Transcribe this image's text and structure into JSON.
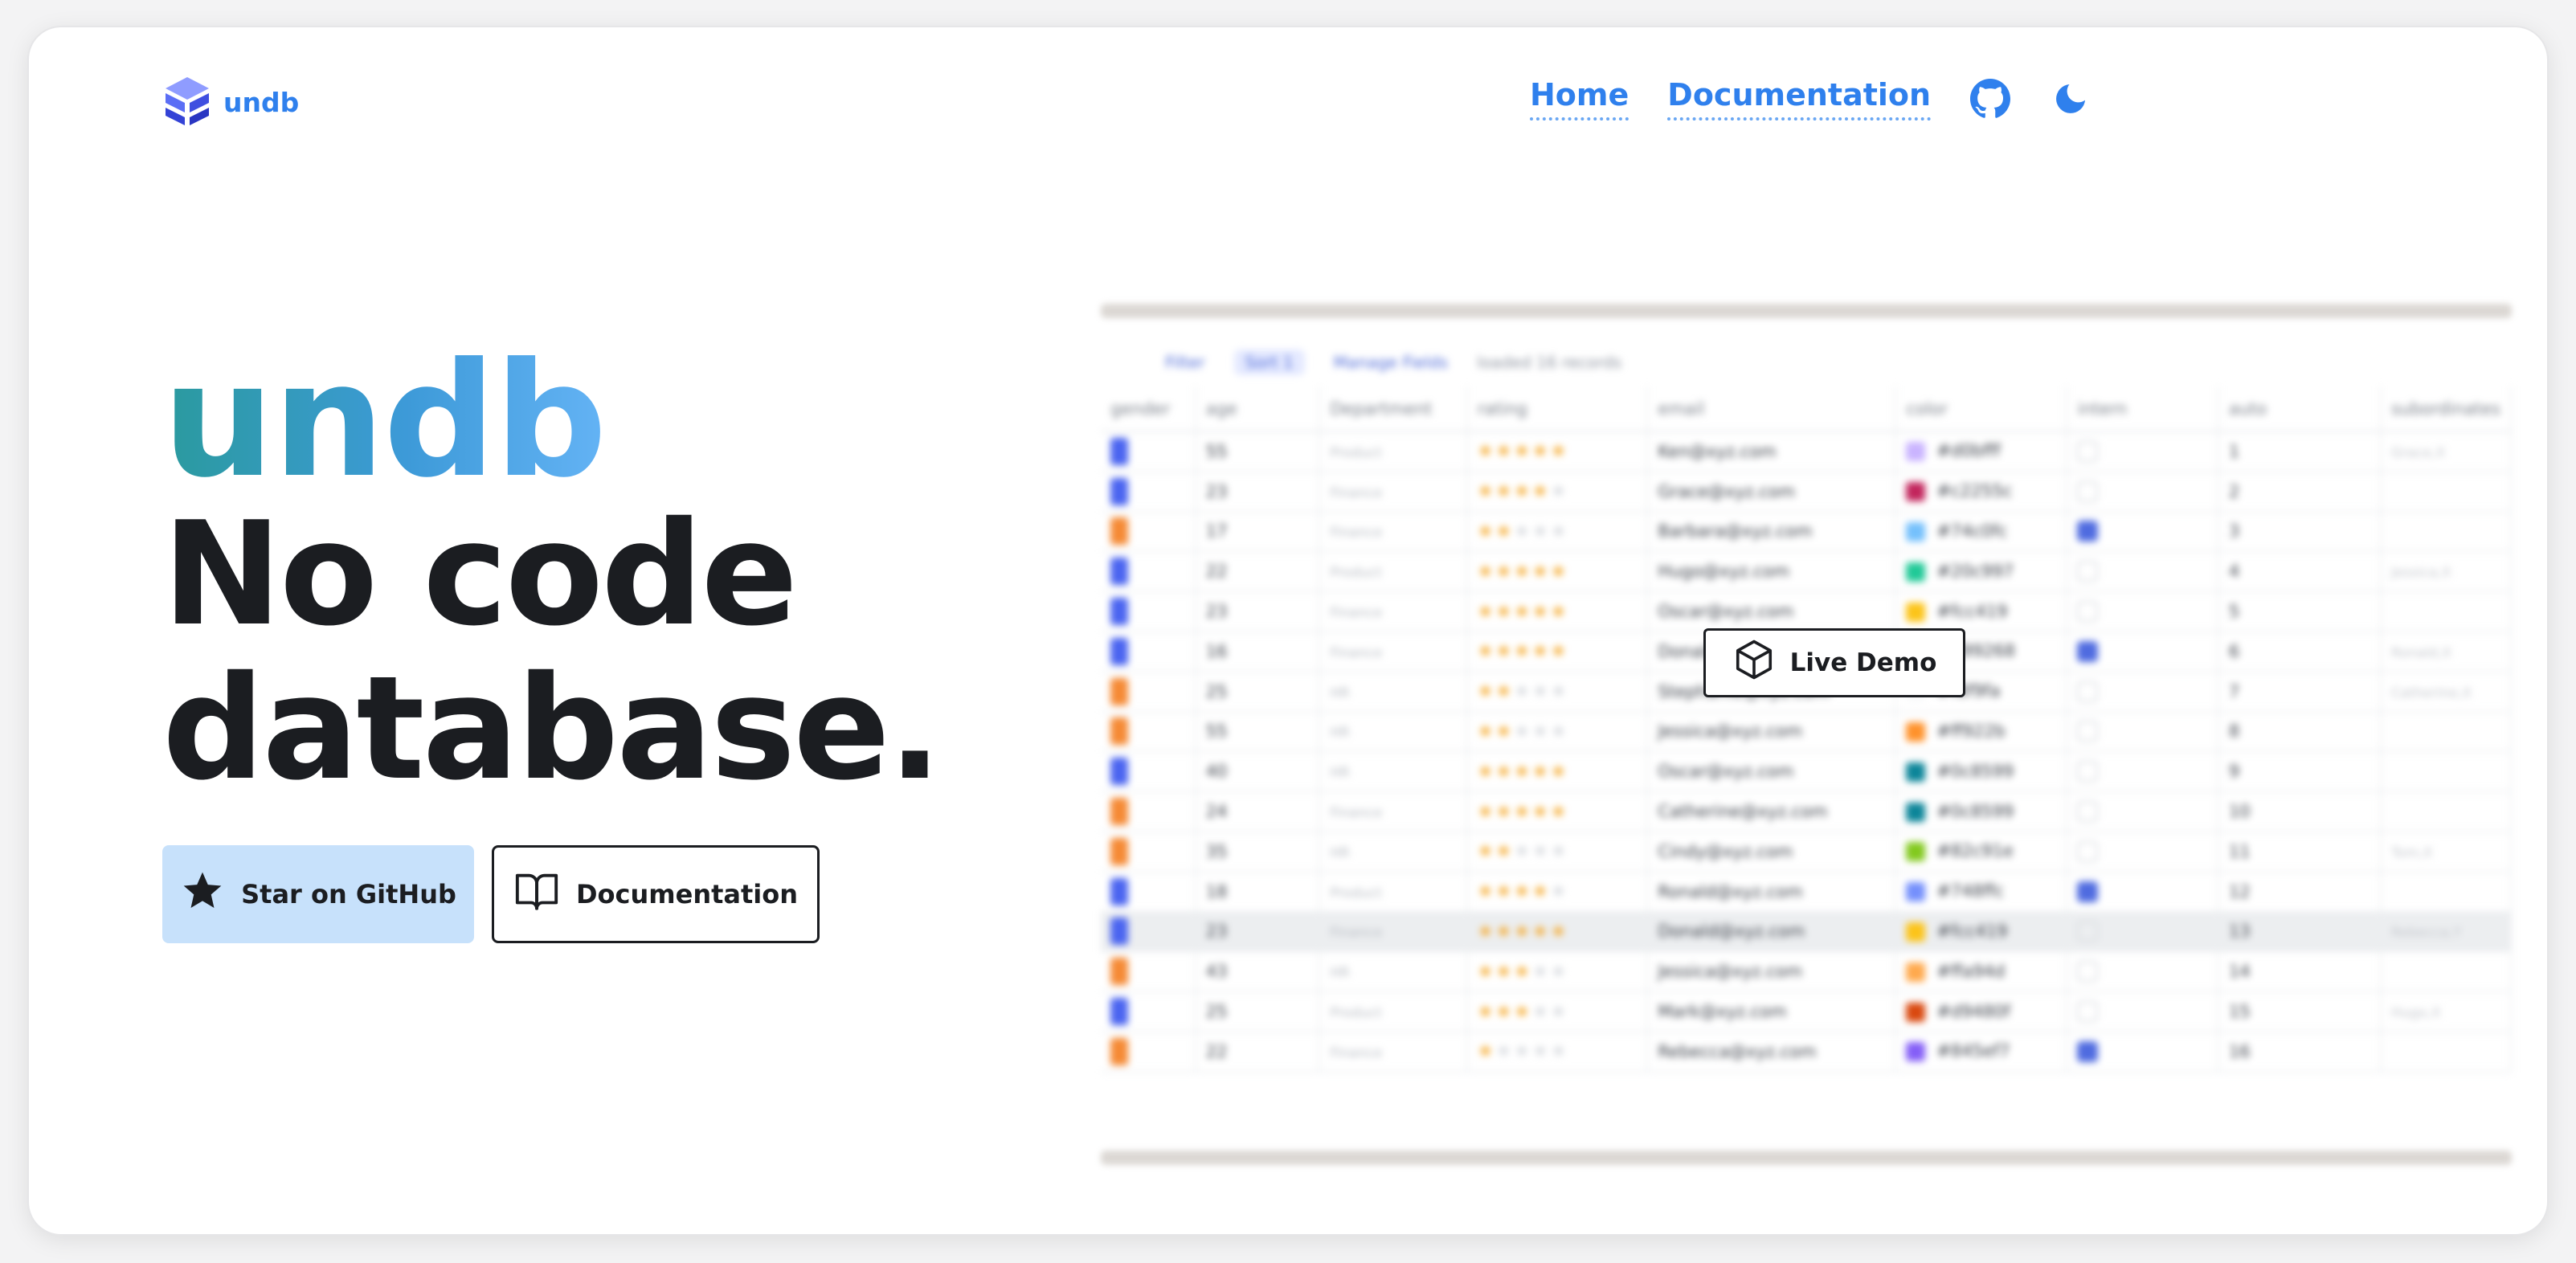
{
  "header": {
    "brand": "undb",
    "nav": [
      {
        "label": "Home"
      },
      {
        "label": "Documentation"
      }
    ],
    "icons": [
      "github-icon",
      "moon-icon"
    ]
  },
  "hero": {
    "brand": "undb",
    "title_line1": "No code",
    "title_line2": "database.",
    "star_button": "Star on GitHub",
    "doc_button": "Documentation",
    "brand_gradient": [
      "#2a9a9e",
      "#64b3f5"
    ]
  },
  "preview": {
    "toolbar": {
      "filter": "Filter",
      "sort": "Sort",
      "sort_count": "1",
      "manage": "Manage Fields",
      "loaded": "loaded 16 records"
    },
    "columns": [
      "gender",
      "age",
      "Department",
      "rating",
      "email",
      "color",
      "intern",
      "auto",
      "subordinates"
    ],
    "rows": [
      {
        "gender": "#4a64f0",
        "age": "55",
        "dept": "Product",
        "rating": 5,
        "email": "Ken@xyz.com",
        "color_swatch": "#c9b3ff",
        "color": "#d0bfff",
        "intern": false,
        "auto": "1",
        "sub": "Grace,X"
      },
      {
        "gender": "#4a64f0",
        "age": "23",
        "dept": "Finance",
        "rating": 4,
        "email": "Grace@xyz.com",
        "color_swatch": "#c2255c",
        "color": "#c2255c",
        "intern": false,
        "auto": "2",
        "sub": ""
      },
      {
        "gender": "#f58a35",
        "age": "17",
        "dept": "Finance",
        "rating": 2,
        "email": "Barbara@xyz.com",
        "color_swatch": "#74c0fc",
        "color": "#74c0fc",
        "intern": true,
        "auto": "3",
        "sub": ""
      },
      {
        "gender": "#4a64f0",
        "age": "22",
        "dept": "Product",
        "rating": 5,
        "email": "Hugo@xyz.com",
        "color_swatch": "#20c997",
        "color": "#20c997",
        "intern": false,
        "auto": "4",
        "sub": "Jessica,X"
      },
      {
        "gender": "#4a64f0",
        "age": "23",
        "dept": "Finance",
        "rating": 5,
        "email": "Oscar@xyz.com",
        "color_swatch": "#fcc419",
        "color": "#fcc419",
        "intern": false,
        "auto": "5",
        "sub": ""
      },
      {
        "gender": "#4a64f0",
        "age": "16",
        "dept": "Finance",
        "rating": 5,
        "email": "Donald@xyz.com",
        "color_swatch": "#099268",
        "color": "#099268",
        "intern": true,
        "auto": "6",
        "sub": "Ronald,X"
      },
      {
        "gender": "#f58a35",
        "age": "25",
        "dept": "HR",
        "rating": 2,
        "email": "Stephanie@xyz.com",
        "color_swatch": "#f8f9fa",
        "color": "#f8f9fa",
        "intern": false,
        "auto": "7",
        "sub": "Catherine,X"
      },
      {
        "gender": "#f58a35",
        "age": "55",
        "dept": "HR",
        "rating": 2,
        "email": "Jessica@xyz.com",
        "color_swatch": "#ff922b",
        "color": "#ff922b",
        "intern": false,
        "auto": "8",
        "sub": ""
      },
      {
        "gender": "#4a64f0",
        "age": "40",
        "dept": "HR",
        "rating": 5,
        "email": "Oscar@xyz.com",
        "color_swatch": "#0c8599",
        "color": "#0c8599",
        "intern": false,
        "auto": "9",
        "sub": ""
      },
      {
        "gender": "#f58a35",
        "age": "24",
        "dept": "Finance",
        "rating": 5,
        "email": "Catherine@xyz.com",
        "color_swatch": "#0c8599",
        "color": "#0c8599",
        "intern": false,
        "auto": "10",
        "sub": ""
      },
      {
        "gender": "#f58a35",
        "age": "35",
        "dept": "HR",
        "rating": 2,
        "email": "Cindy@xyz.com",
        "color_swatch": "#82c91e",
        "color": "#82c91e",
        "intern": false,
        "auto": "11",
        "sub": "Tom,X"
      },
      {
        "gender": "#4a64f0",
        "age": "18",
        "dept": "Product",
        "rating": 4,
        "email": "Ronald@xyz.com",
        "color_swatch": "#748ffc",
        "color": "#748ffc",
        "intern": true,
        "auto": "12",
        "sub": ""
      },
      {
        "gender": "#4a64f0",
        "age": "23",
        "dept": "Finance",
        "rating": 5,
        "email": "Donald@xyz.com",
        "color_swatch": "#fcc419",
        "color": "#fcc419",
        "intern": false,
        "auto": "13",
        "sub": "Rebecca,Y"
      },
      {
        "gender": "#f58a35",
        "age": "43",
        "dept": "HR",
        "rating": 3,
        "email": "Jessica@xyz.com",
        "color_swatch": "#ffa94d",
        "color": "#ffa94d",
        "intern": false,
        "auto": "14",
        "sub": ""
      },
      {
        "gender": "#4a64f0",
        "age": "25",
        "dept": "Product",
        "rating": 3,
        "email": "Mark@xyz.com",
        "color_swatch": "#d9480f",
        "color": "#d9480f",
        "intern": false,
        "auto": "15",
        "sub": "Hugo,X"
      },
      {
        "gender": "#f58a35",
        "age": "22",
        "dept": "Finance",
        "rating": 1,
        "email": "Rebecca@xyz.com",
        "color_swatch": "#845ef7",
        "color": "#845ef7",
        "intern": true,
        "auto": "16",
        "sub": ""
      }
    ],
    "highlighted_row": 12,
    "live_demo": "Live Demo"
  },
  "colors": {
    "accent": "#2f80ed",
    "star_button_bg": "#c7e1fb",
    "text": "#1b1d21"
  }
}
